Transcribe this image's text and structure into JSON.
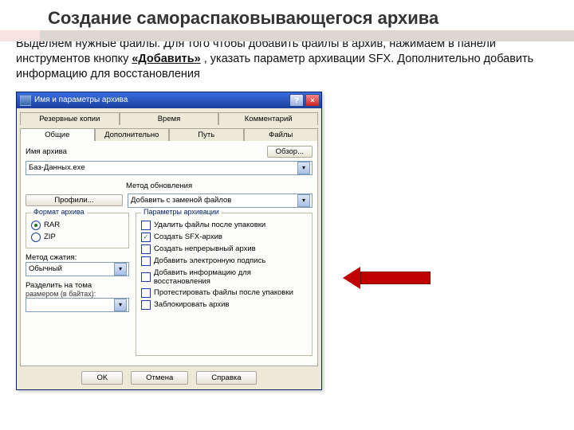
{
  "slide": {
    "title": "Создание самораспаковывающегося архива",
    "intro_1": "Выделяем нужные файлы. Для того чтобы добавить файлы в архив, нажимаем в панели инструментов кнопку ",
    "intro_bold": "«Добавить»",
    "intro_2": " ,  указать параметр архивации SFX. Дополнительно добавить информацию для восстановления"
  },
  "dialog": {
    "title": "Имя и параметры архива",
    "help_glyph": "?",
    "close_glyph": "×",
    "tabs_row1": [
      "Резервные копии",
      "Время",
      "Комментарий"
    ],
    "tabs_row2": [
      "Общие",
      "Дополнительно",
      "Путь",
      "Файлы"
    ],
    "name_label": "Имя архива",
    "name_value": "Баз-Данных.exe",
    "browse_btn": "Обзор...",
    "update_label": "Метод обновления",
    "update_value": "Добавить с заменой файлов",
    "profiles_btn": "Профили...",
    "group_format": "Формат архива",
    "fmt_rar": "RAR",
    "fmt_zip": "ZIP",
    "method_label": "Метод сжатия:",
    "method_value": "Обычный",
    "split_label1": "Разделить на тома",
    "split_label2": "размером (в байтах):",
    "split_value": "",
    "group_params": "Параметры архивации",
    "p1": "Удалить файлы после упаковки",
    "p2": "Создать SFX-архив",
    "p3": "Создать непрерывный архив",
    "p4": "Добавить электронную подпись",
    "p5": "Добавить информацию для восстановления",
    "p6": "Протестировать файлы после упаковки",
    "p7": "Заблокировать архив",
    "btn_ok": "OK",
    "btn_cancel": "Отмена",
    "btn_help": "Справка"
  }
}
